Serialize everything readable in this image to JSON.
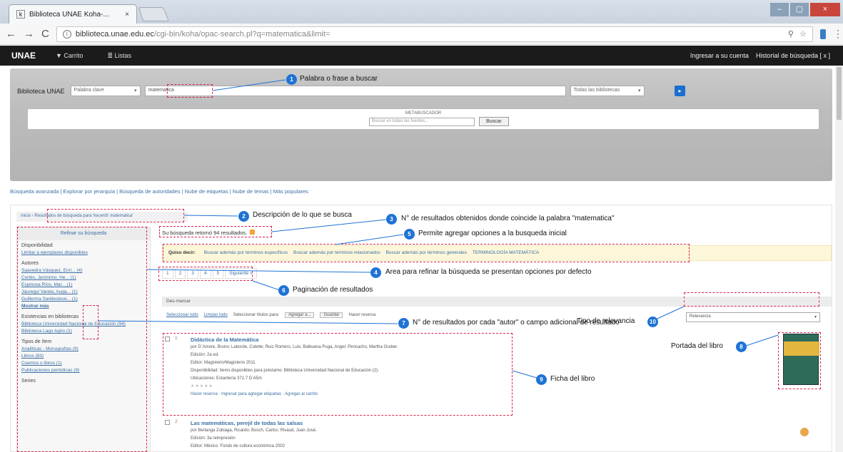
{
  "browser": {
    "tab_title": "Biblioteca UNAE Koha-...",
    "tab_close": "×",
    "url_host": "biblioteca.unae.edu.ec",
    "url_path": "/cgi-bin/koha/opac-search.pl?q=matematica&limit=",
    "win_min": "–",
    "win_max": "▢",
    "win_close": "×",
    "back": "←",
    "forward": "→",
    "reload": "C"
  },
  "navbar": {
    "brand": "UNAE",
    "cart": "▼ Carrito",
    "lists": "≣ Listas",
    "login": "Ingresar a su cuenta",
    "history": "Historial de búsqueda [ x ]"
  },
  "search": {
    "library_label": "Biblioteca UNAE",
    "field_select": "Palabra clave",
    "query": "matematica",
    "libraries_select": "Todas las bibliotecas",
    "go": "▸",
    "meta_title": "METABUSCADOR",
    "meta_placeholder": "Buscar en todas las fuentes...",
    "meta_button": "Buscar"
  },
  "links_row": "Búsqueda avanzada | Explorar por jerarquía | Búsqueda de autoridades | Nube de etiquetas | Nube de temas | Más populares",
  "breadcrumb": {
    "home": "Inicio",
    "current": "Resultados de búsqueda para 'kw,wrdl: matematica'"
  },
  "facets": {
    "header": "Refinar su búsqueda",
    "groups": [
      {
        "title": "Disponibilidad",
        "items": [
          "Limitar a ejemplares disponibles"
        ]
      },
      {
        "title": "Autores",
        "items": [
          "Saavedra Vásquez, Enri... (4)",
          "Cortés, Jerónimo, He... (1)",
          "Espinosa Ríos, Mar... (1)",
          "Jáuregui Varela, Auga... (1)",
          "Guillerma Santiesteve... (1)",
          "Mostrar más"
        ]
      },
      {
        "title": "Existencias en bibliotecas",
        "items": [
          "Biblioteca Universidad Nacional de Educación (94)",
          "Biblioteca Lago Agrio (1)"
        ]
      },
      {
        "title": "Tipos de ítem",
        "items": [
          "Analíticas - Monografías (9)",
          "Libros (83)",
          "Cuentos o libros (1)",
          "Publicaciones periódicas (9)"
        ]
      },
      {
        "title": "Series",
        "items": []
      }
    ]
  },
  "results": {
    "count_text": "Su búsqueda retornó 94 resultados.",
    "did_you_mean_label": "Quiso decir:",
    "suggestions": [
      "Buscar además por términos específicos",
      "Buscar además por términos relacionados",
      "Buscar además por términos generales",
      "TERMINOLOGÍA MATEMÁTICA"
    ],
    "pages": [
      "1",
      "2",
      "3",
      "4",
      "5",
      "Siguiente »"
    ],
    "deselect": "Des-marcar",
    "select_all": "Seleccionar todo",
    "clear_all": "Limpiar todo",
    "select_label": "Seleccionar títulos para:",
    "add_to": "Agregar a...",
    "save": "Guardar",
    "hold": "Hacer reserva",
    "relevance": "Relevancia",
    "records": [
      {
        "num": "1",
        "title": "Didáctica de la Matemática",
        "authors": "por D`Amore, Bruno; Laborde, Colette; Ruiz Romero, Luis; Balbuena Puga, Angel; Pericacho, Martha Graber.",
        "edition": "Edición: 2a ed.",
        "material": "Editor: Magisterio/Magisterio 2011",
        "availability": "Disponibilidad: Items disponibles para préstamo: Biblioteca Universidad Nacional de Educación (2).",
        "location": "Ubicaciones: Estantería 372.7 D A5m",
        "stars": "★★★★★",
        "actions": [
          "Hacer reserva",
          "Ingresar para agregar etiquetas",
          "Agregar al carrito"
        ]
      },
      {
        "num": "2",
        "title": "Las matemáticas, perejil de todas las salsas",
        "authors": "por Berlanga Zubiaga, Ricardo; Bosch, Carlos; Rivaud, Juan José.",
        "edition": "Edición: 3a reimpresión",
        "material": "Editor: México: Fondo de cultura económica 2002"
      }
    ]
  },
  "annotations": [
    {
      "n": "1",
      "text": "Palabra o frase a buscar"
    },
    {
      "n": "2",
      "text": "Descripción de lo que se busca"
    },
    {
      "n": "3",
      "text": "N° de resultados obtenidos donde coincide la palabra \"matematica\""
    },
    {
      "n": "4",
      "text": "Area para refinar la búsqueda se presentan opciones por defecto"
    },
    {
      "n": "5",
      "text": "Permite agregar opciones a la busqueda inicial"
    },
    {
      "n": "6",
      "text": "Paginación de resultados"
    },
    {
      "n": "7",
      "text": "N° de resultados por cada \"autor\" o campo adicional de resultado"
    },
    {
      "n": "8",
      "text": "Portada del libro"
    },
    {
      "n": "9",
      "text": "Ficha del libro"
    },
    {
      "n": "10",
      "text": "Tipo de relevancia"
    }
  ],
  "colors": {
    "annotation_dash": "#d6264b",
    "marker": "#1f73d4",
    "navbar": "#1b1b1b",
    "link": "#3a6fa5"
  }
}
